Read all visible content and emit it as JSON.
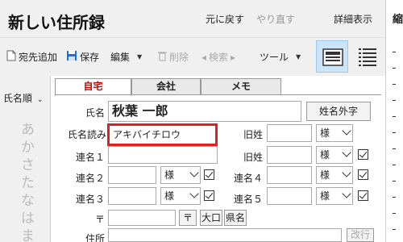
{
  "app": {
    "title": "新しい住所録",
    "undo": "元に戻す",
    "redo": "やり直す",
    "details": "詳細表示"
  },
  "right_panel": {
    "title": "縮"
  },
  "toolbar": {
    "add_recipient": "宛先追加",
    "save": "保存",
    "edit": "編集",
    "delete": "削除",
    "search": "検索",
    "tools": "ツール"
  },
  "sidebar": {
    "sort_label": "氏名順",
    "kana": [
      "あ",
      "か",
      "さ",
      "た",
      "な",
      "は",
      "ま"
    ]
  },
  "tabs": [
    "自宅",
    "会社",
    "メモ"
  ],
  "form": {
    "name_label": "氏名",
    "name_value": "秋葉 一郎",
    "name_extra_button": "姓名外字",
    "reading_label": "氏名読み",
    "reading_value": "アキバイチロウ",
    "old_surname_label_1": "旧姓",
    "old_surname_label_2": "旧姓",
    "honorific": "様",
    "renmei1_label": "連名１",
    "renmei2_label": "連名２",
    "renmei3_label": "連名３",
    "renmei4_label": "連名４",
    "renmei5_label": "連名５",
    "postal_label": "〒",
    "postal_button": "〒",
    "oguchi_button": "大口",
    "prefecture_button": "県名",
    "address_label": "住所",
    "newline_button": "改行"
  },
  "colors": {
    "active_tab_text": "#cc0000",
    "highlight_border": "#e02020",
    "view_active_bg": "#cce4f7"
  }
}
